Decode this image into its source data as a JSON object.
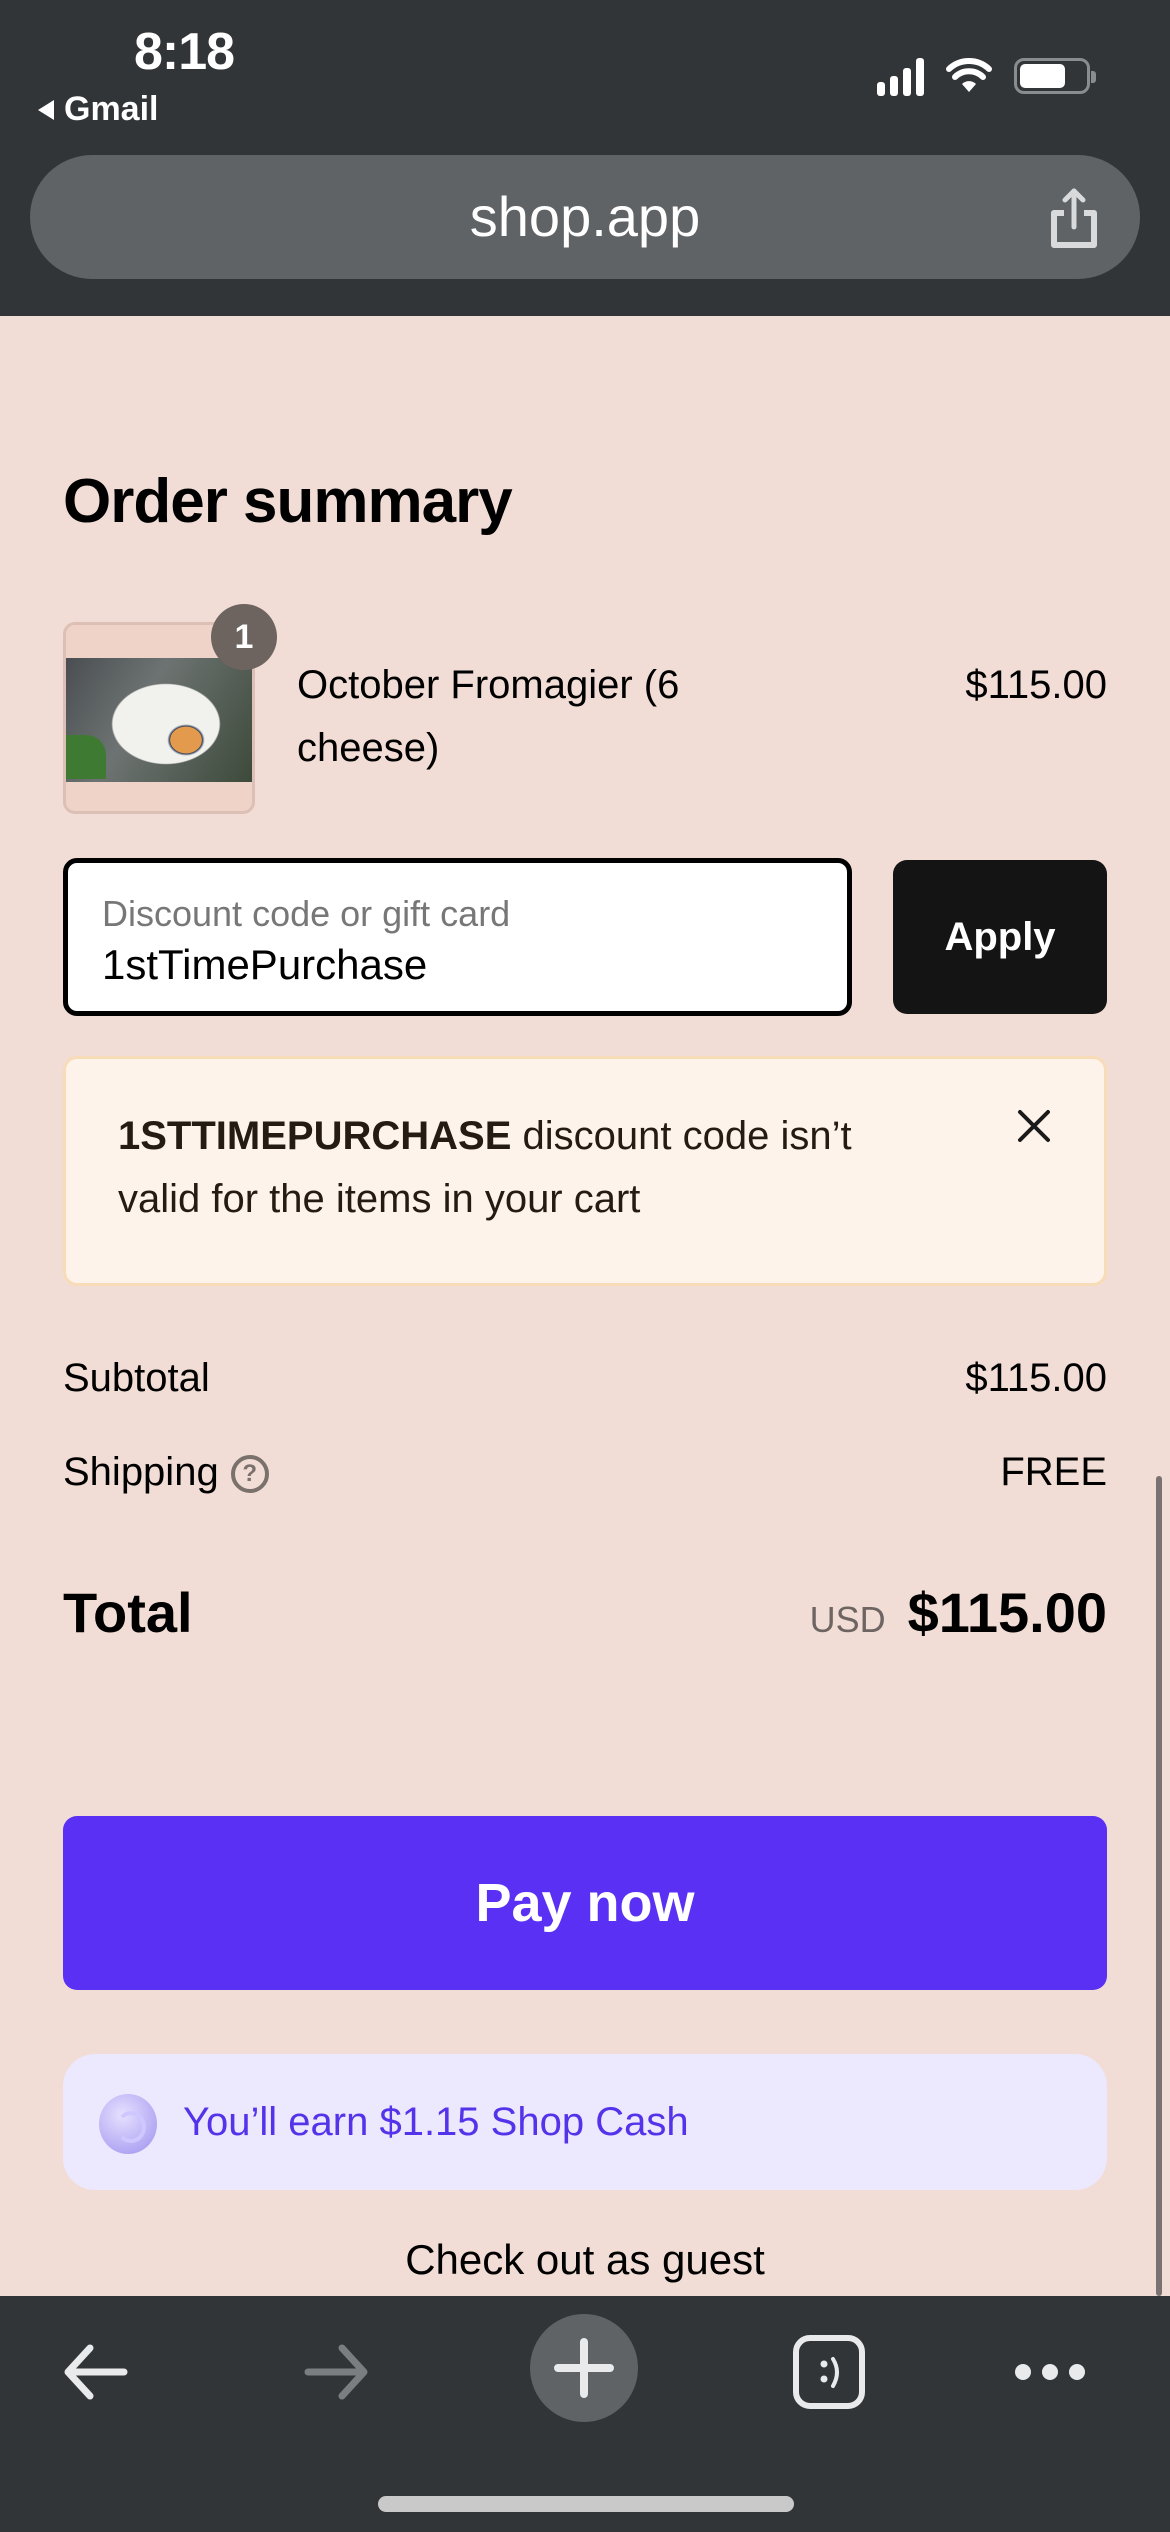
{
  "status_bar": {
    "time": "8:18",
    "back_app": "Gmail"
  },
  "browser": {
    "url": "shop.app"
  },
  "order_summary": {
    "title": "Order summary",
    "items": [
      {
        "name": "October Fromagier (6 cheese)",
        "price": "$115.00",
        "quantity": "1"
      }
    ]
  },
  "discount": {
    "placeholder": "Discount code or gift card",
    "value": "1stTimePurchase",
    "apply_label": "Apply"
  },
  "alert": {
    "code": "1STTIMEPURCHASE",
    "message": " discount code isn’t valid for the items in your cart"
  },
  "totals": {
    "subtotal_label": "Subtotal",
    "subtotal_value": "$115.00",
    "shipping_label": "Shipping",
    "shipping_value": "FREE",
    "total_label": "Total",
    "currency": "USD",
    "total_value": "$115.00"
  },
  "actions": {
    "pay_label": "Pay now",
    "shop_cash": "You’ll earn $1.15 Shop Cash",
    "guest_label": "Check out as guest"
  },
  "colors": {
    "page_bg": "#f1ddd5",
    "pay_button": "#5a31f4",
    "shop_cash_text": "#5433eb",
    "alert_bg": "#fdf3ea"
  }
}
